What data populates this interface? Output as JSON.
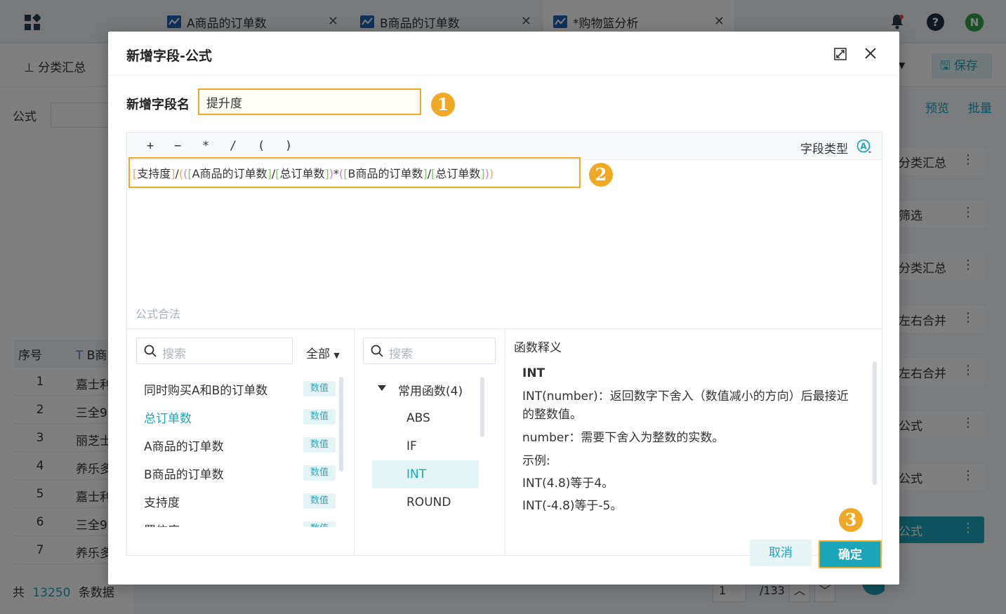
{
  "tabs": [
    {
      "label": "A商品的订单数"
    },
    {
      "label": "B商品的订单数"
    },
    {
      "label": "*购物篮分析"
    }
  ],
  "topbar": {
    "user_initial": "N",
    "save_label": "保存",
    "preview_label": "预览",
    "batch_label": "批量"
  },
  "background": {
    "toolbar_item": "分类汇总",
    "formula_label": "公式",
    "columns": [
      "序号",
      "B商"
    ],
    "rows": [
      {
        "num": "1",
        "val": "嘉士利"
      },
      {
        "num": "2",
        "val": "三全9"
      },
      {
        "num": "3",
        "val": "丽芝士"
      },
      {
        "num": "4",
        "val": "养乐多"
      },
      {
        "num": "5",
        "val": "嘉士利"
      },
      {
        "num": "6",
        "val": "三全9"
      },
      {
        "num": "7",
        "val": "养乐多"
      }
    ],
    "footer": {
      "prefix": "共",
      "count": "13250",
      "suffix": "条数据",
      "page": "1",
      "total_pages": "/133"
    },
    "steps": [
      "分类汇总",
      "筛选",
      "分类汇总",
      "左右合并",
      "左右合并",
      "公式",
      "公式",
      "公式"
    ]
  },
  "dialog": {
    "title": "新增字段-公式",
    "field_name_label": "新增字段名",
    "field_name_value": "提升度",
    "operators": [
      "+",
      "−",
      "*",
      "/",
      "(",
      ")"
    ],
    "field_type_label": "字段类型",
    "formula_status": "公式合法",
    "formula": {
      "f1": "支持度",
      "f2": "A商品的订单数",
      "f3": "总订单数",
      "f4": "B商品的订单数",
      "f5": "总订单数"
    },
    "field_search_placeholder": "搜索",
    "filter_label": "全部",
    "fields": [
      {
        "name": "同时购买A和B的订单数",
        "type": "数值"
      },
      {
        "name": "总订单数",
        "type": "数值"
      },
      {
        "name": "A商品的订单数",
        "type": "数值"
      },
      {
        "name": "B商品的订单数",
        "type": "数值"
      },
      {
        "name": "支持度",
        "type": "数值"
      },
      {
        "name": "置信度",
        "type": "数值"
      }
    ],
    "function_search_placeholder": "搜索",
    "function_group": "常用函数(4)",
    "functions": [
      "ABS",
      "IF",
      "INT",
      "ROUND"
    ],
    "doc_title": "函数释义",
    "doc": {
      "name": "INT",
      "line1": "INT(number)：返回数字下舍入（数值减小的方向）后最接近的整数值。",
      "line2": "number：需要下舍入为整数的实数。",
      "line3": "示例:",
      "line4": "INT(4.8)等于4。",
      "line5": "INT(-4.8)等于-5。"
    },
    "cancel_label": "取消",
    "ok_label": "确定"
  },
  "annotations": [
    "1",
    "2",
    "3"
  ]
}
